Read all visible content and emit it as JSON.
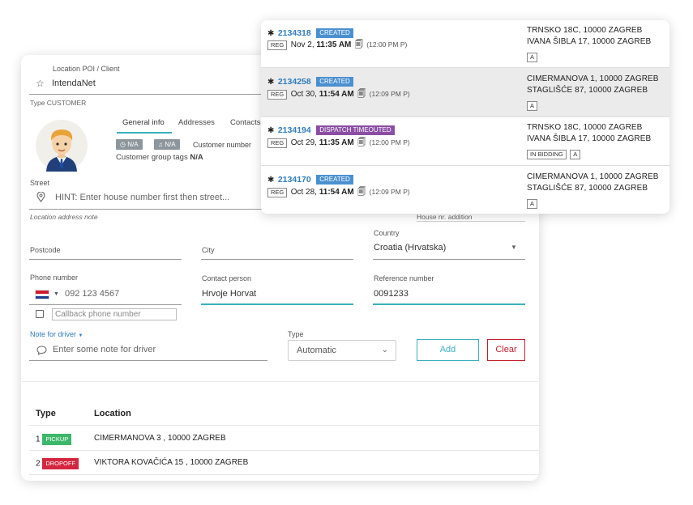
{
  "form": {
    "location_label": "Location POI / Client",
    "location_value": "IntendaNet",
    "type_label": "Type CUSTOMER",
    "tabs": [
      {
        "label": "General info"
      },
      {
        "label": "Addresses"
      },
      {
        "label": "Contacts"
      }
    ],
    "badges": [
      {
        "label": "N/A"
      },
      {
        "label": "N/A"
      }
    ],
    "customer_number_label": "Customer number",
    "customer_group_label": "Customer group tags",
    "customer_group_value": "N/A",
    "street_label": "Street",
    "street_placeholder": "HINT: Enter house number first then street...",
    "location_note_label": "Location address note",
    "house_nr_label": "House nr. addition",
    "postcode_label": "Postcode",
    "city_label": "City",
    "country_label": "Country",
    "country_value": "Croatia (Hrvatska)",
    "phone_label": "Phone number",
    "phone_value": "092 123 4567",
    "callback_placeholder": "Callback phone number",
    "contact_label": "Contact person",
    "contact_value": "Hrvoje Horvat",
    "reference_label": "Reference number",
    "reference_value": "0091233",
    "note_label": "Note for driver",
    "note_placeholder": "Enter some note for driver",
    "type_select_label": "Type",
    "type_select_value": "Automatic",
    "add_label": "Add",
    "clear_label": "Clear"
  },
  "stops": {
    "headers": {
      "type": "Type",
      "location": "Location"
    },
    "rows": [
      {
        "num": "1",
        "type": "PICKUP",
        "location": "CIMERMANOVA 3 , 10000 ZAGREB"
      },
      {
        "num": "2",
        "type": "DROPOFF",
        "location": "VIKTORA KOVAČIĆA 15 , 10000 ZAGREB"
      }
    ]
  },
  "orders": [
    {
      "id": "2134318",
      "status": "CREATED",
      "tag": "REG",
      "date": "Nov 2,",
      "time": "11:35 AM",
      "sub": "(12:00 PM P)",
      "addr1": "TRNSKO 18C, 10000 ZAGREB",
      "addr2": "IVANA ŠIBLA 17, 10000 ZAGREB",
      "tags": [
        "A"
      ]
    },
    {
      "id": "2134258",
      "status": "CREATED",
      "tag": "REG",
      "date": "Oct 30,",
      "time": "11:54 AM",
      "sub": "(12:09 PM P)",
      "addr1": "CIMERMANOVA 1, 10000 ZAGREB",
      "addr2": "STAGLIŠĆE 87, 10000 ZAGREB",
      "tags": [
        "A"
      ]
    },
    {
      "id": "2134194",
      "status": "DISPATCH TIMEOUTED",
      "tag": "REG",
      "date": "Oct 29,",
      "time": "11:35 AM",
      "sub": "(12:00 PM P)",
      "addr1": "TRNSKO 18C, 10000 ZAGREB",
      "addr2": "IVANA ŠIBLA 17, 10000 ZAGREB",
      "tags": [
        "IN BIDDING",
        "A"
      ]
    },
    {
      "id": "2134170",
      "status": "CREATED",
      "tag": "REG",
      "date": "Oct 28,",
      "time": "11:54 AM",
      "sub": "(12:09 PM P)",
      "addr1": "CIMERMANOVA 1, 10000 ZAGREB",
      "addr2": "STAGLIŠĆE 87, 10000 ZAGREB",
      "tags": [
        "A"
      ]
    }
  ],
  "colors": {
    "accent": "#3ab0bd",
    "link": "#2f7dbd",
    "danger": "#c2202f",
    "pickup": "#3db86b",
    "dropoff": "#d4263e",
    "created": "#4a90d0",
    "timeout": "#8a4ea3"
  }
}
